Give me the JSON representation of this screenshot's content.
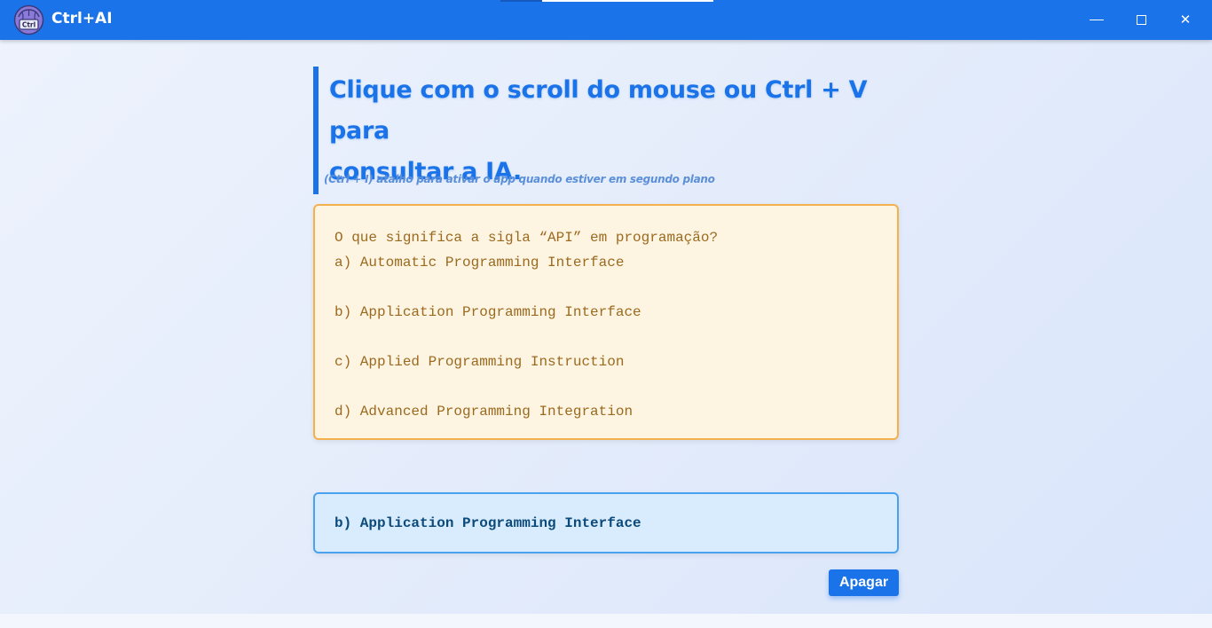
{
  "app": {
    "title": "Ctrl+AI",
    "logo_icon": "brain-ctrl-icon",
    "logo_text": "Ctrl"
  },
  "window_controls": {
    "minimize_icon": "minimize-icon",
    "maximize_icon": "maximize-icon",
    "close_icon": "close-icon",
    "close_glyph": "✕"
  },
  "heading": {
    "line1": "Clique com o scroll do mouse ou Ctrl + V para",
    "line2": "consultar a IA."
  },
  "hint": "(Ctrl + I) atalho para ativar o app quando estiver em segundo plano",
  "question": {
    "text": "O que significa a sigla “API” em programação?",
    "options": [
      "a) Automatic Programming Interface",
      "b) Application Programming Interface",
      "c) Applied Programming Instruction",
      "d) Advanced Programming Integration"
    ]
  },
  "answer": "b) Application Programming Interface",
  "buttons": {
    "clear_label": "Apagar"
  },
  "colors": {
    "accent": "#1a73e8",
    "question_bg": "#fef4e2",
    "question_border": "#f5b04e",
    "answer_bg": "#d8ecfd",
    "answer_border": "#4aa2ee"
  }
}
